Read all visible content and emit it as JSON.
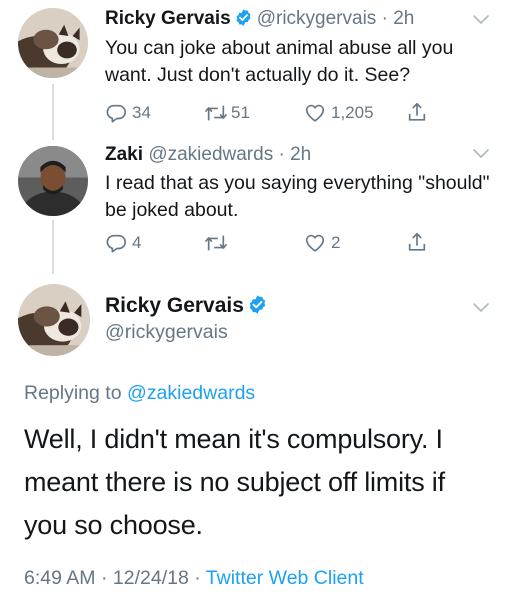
{
  "tweet1": {
    "author_name": "Ricky Gervais",
    "author_handle": "@rickygervais",
    "separator": "·",
    "time": "2h",
    "text": "You can joke about animal abuse all you want. Just don't actually do it. See?",
    "replies": "34",
    "retweets": "51",
    "likes": "1,205"
  },
  "tweet2": {
    "author_name": "Zaki",
    "author_handle": "@zakiedwards",
    "separator": "·",
    "time": "2h",
    "text": "I read that as you saying everything \"should\" be joked about.",
    "replies": "4",
    "retweets": "",
    "likes": "2"
  },
  "main_tweet": {
    "author_name": "Ricky Gervais",
    "author_handle": "@rickygervais",
    "replying_prefix": "Replying to",
    "replying_to": "@zakiedwards",
    "text": "Well, I didn't mean it's compulsory. I meant there is no subject off limits if you so choose.",
    "time": "6:49 AM",
    "separator1": "·",
    "date": "12/24/18",
    "separator2": "·",
    "client": "Twitter Web Client"
  },
  "icons": {
    "reply": "reply-icon",
    "retweet": "retweet-icon",
    "like": "heart-icon",
    "share": "share-icon",
    "verified": "verified-badge-icon",
    "more": "chevron-down-icon"
  },
  "colors": {
    "accent": "#1da1f2",
    "secondary_text": "#657786",
    "primary_text": "#14171a"
  }
}
